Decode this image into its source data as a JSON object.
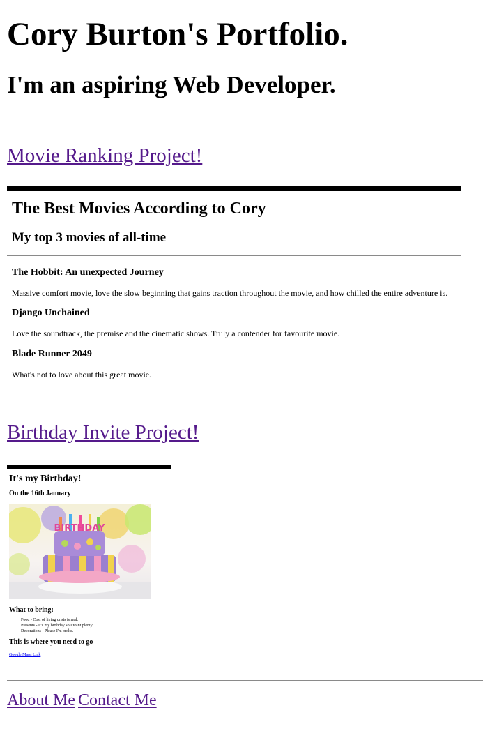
{
  "header": {
    "title": "Cory Burton's Portfolio.",
    "subtitle": "I'm an aspiring Web Developer."
  },
  "projects": {
    "movie_link": "Movie Ranking Project!",
    "birthday_link": "Birthday Invite Project!"
  },
  "movie_page": {
    "heading": "The Best Movies According to Cory",
    "subheading": "My top 3 movies of all-time",
    "movies": [
      {
        "title": "The Hobbit: An unexpected Journey",
        "description": "Massive comfort movie, love the slow beginning that gains traction throughout the movie, and how chilled the entire adventure is."
      },
      {
        "title": "Django Unchained",
        "description": "Love the soundtrack, the premise and the cinematic shows. Truly a contender for favourite movie."
      },
      {
        "title": "Blade Runner 2049",
        "description": "What's not to love about this great movie."
      }
    ]
  },
  "birthday_page": {
    "heading": "It's my Birthday!",
    "date": "On the 16th January",
    "image_icon": "birthday-cake-image",
    "bring_heading": "What to bring:",
    "bring_items": [
      "Food - Cost of living crisis is real.",
      "Presents - It's my birthday so I want plenty.",
      "Decorations - Please I'm broke."
    ],
    "location_heading": "This is where you need to go",
    "map_link": "Google Maps Link"
  },
  "footer": {
    "about_link": "About Me",
    "contact_link": "Contact Me"
  },
  "colors": {
    "visited_link": "#551a8b",
    "link": "#0000ee",
    "rule": "#8a8a8a"
  }
}
